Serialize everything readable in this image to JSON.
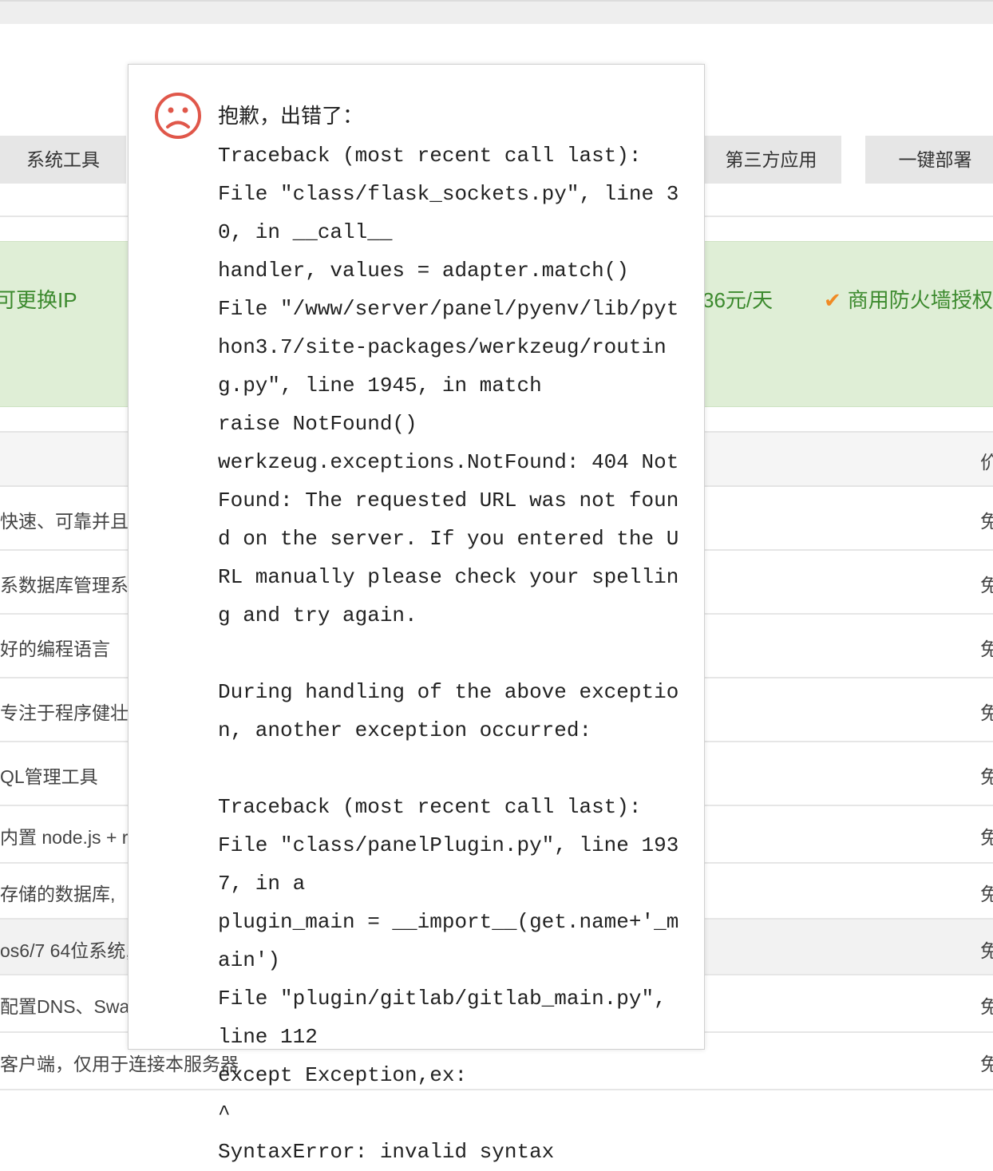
{
  "tabs": {
    "system_tools": "系统工具",
    "third_party": "第三方应用",
    "one_click_deploy": "一键部署"
  },
  "banner": {
    "left_text": "可更换IP",
    "mid_text": "36元/天",
    "right_text": "商用防火墙授权"
  },
  "table": {
    "header_price": "价",
    "rows": [
      {
        "desc": "快速、可靠并且",
        "price": "免"
      },
      {
        "desc": "系数据库管理系",
        "price": "免"
      },
      {
        "desc": "好的编程语言",
        "price": "免"
      },
      {
        "desc": "专注于程序健壮",
        "price": "免"
      },
      {
        "desc": "QL管理工具",
        "price": "免"
      },
      {
        "desc": "内置 node.js + r",
        "price": "免"
      },
      {
        "desc": "存储的数据库,",
        "price": "免"
      },
      {
        "desc": "os6/7 64位系统,",
        "price": "免"
      },
      {
        "desc": "配置DNS、Swa",
        "price": "免"
      },
      {
        "desc": "客户端，仅用于连接本服务器",
        "price": "免"
      }
    ]
  },
  "error_dialog": {
    "icon": "sad-face-icon",
    "title": "抱歉，出错了：",
    "message": "Traceback (most recent call last):\nFile \"class/flask_sockets.py\", line 30, in __call__\nhandler, values = adapter.match()\nFile \"/www/server/panel/pyenv/lib/python3.7/site-packages/werkzeug/routing.py\", line 1945, in match\nraise NotFound()\nwerkzeug.exceptions.NotFound: 404 Not Found: The requested URL was not found on the server. If you entered the URL manually please check your spelling and try again.\n\nDuring handling of the above exception, another exception occurred:\n\nTraceback (most recent call last):\nFile \"class/panelPlugin.py\", line 1937, in a\nplugin_main = __import__(get.name+'_main')\nFile \"plugin/gitlab/gitlab_main.py\", line 112\nexcept Exception,ex:\n^\nSyntaxError: invalid syntax"
  },
  "colors": {
    "banner_bg": "#dfeed6",
    "banner_text": "#3c8a2e",
    "check": "#f08a24",
    "sad_icon": "#e0574a"
  }
}
